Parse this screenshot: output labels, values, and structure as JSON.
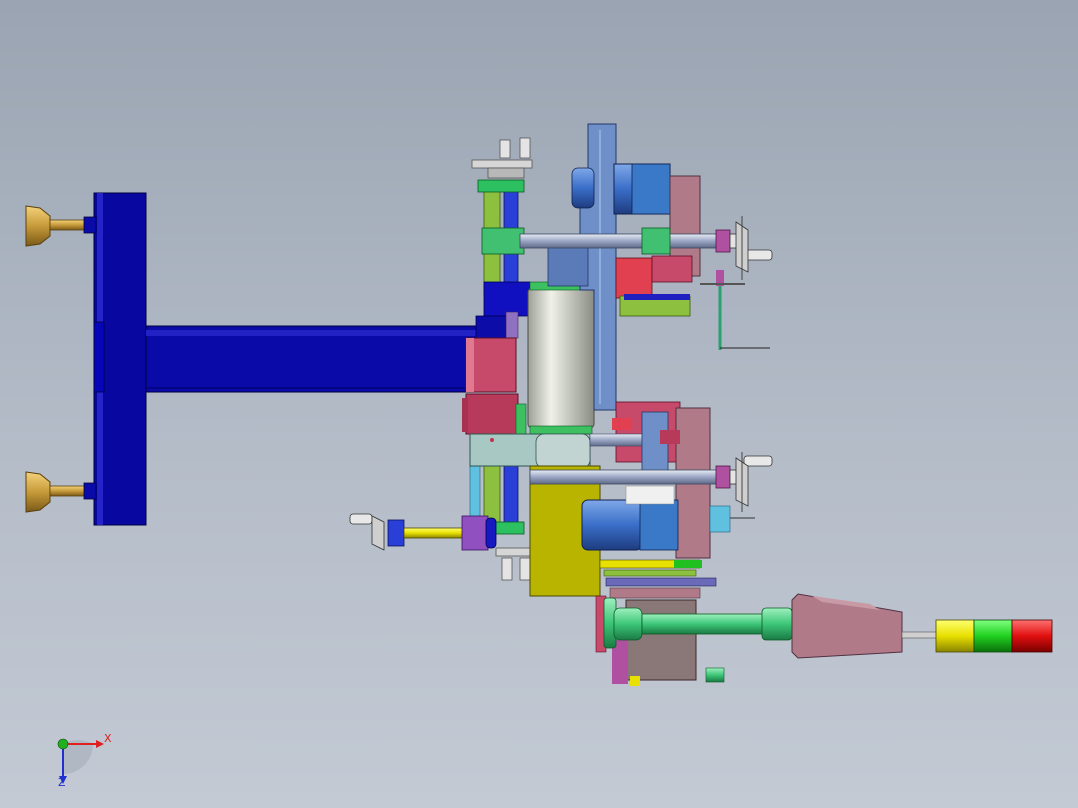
{
  "app": {
    "view": "cad-viewport"
  },
  "triad": {
    "x_label": "X",
    "z_label": "Z",
    "x_color": "#e02020",
    "z_color": "#2030d0",
    "y_color": "#20b020"
  },
  "colors": {
    "frame_blue": "#0a0aa8",
    "brass": "#c79a3a",
    "roller_gray": "#d8dad0",
    "pink": "#c05070",
    "olive": "#b8b400",
    "steel_blue": "#6e8fc8",
    "mauve": "#b07a88",
    "green": "#3cc060",
    "tower_yellow": "#e8e000",
    "tower_green": "#20d020",
    "tower_red": "#e01010"
  }
}
